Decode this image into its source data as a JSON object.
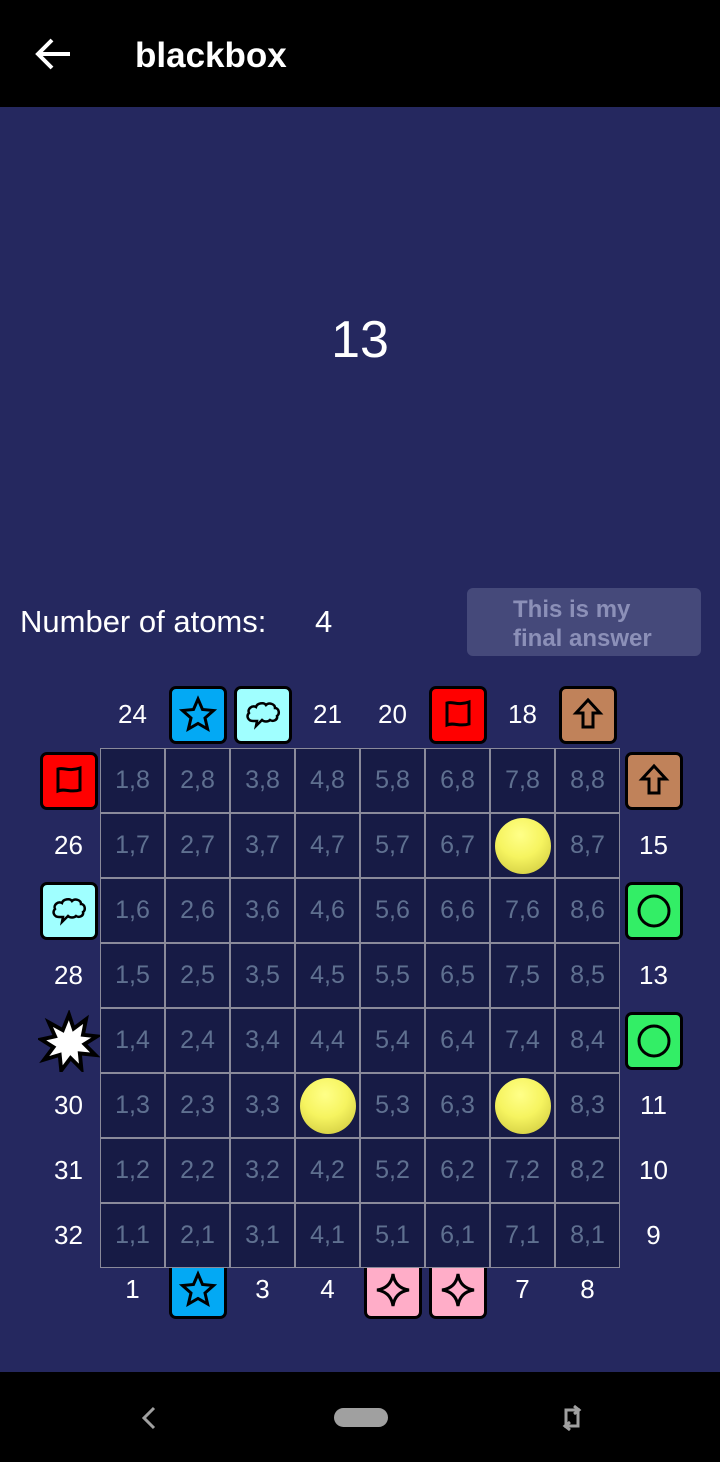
{
  "app": {
    "title": "blackbox",
    "back_icon": "arrow-left-icon"
  },
  "score": "13",
  "atoms": {
    "label": "Number of atoms:",
    "count": "4"
  },
  "final_button": {
    "line1": "This is my",
    "line2": "final answer"
  },
  "colors": {
    "background": "#25285f",
    "cell": "#171b45",
    "blue_star": "#03a9f4",
    "cyan_cloud": "#a0ffff",
    "red_flag": "#ff0000",
    "brown_arrow": "#c0825a",
    "green_circle": "#33ee66",
    "pink_sparkle": "#ffadc8"
  },
  "board": {
    "top": [
      {
        "label": "24"
      },
      {
        "marker": "star"
      },
      {
        "marker": "cloud"
      },
      {
        "label": "21"
      },
      {
        "label": "20"
      },
      {
        "marker": "flag"
      },
      {
        "label": "18"
      },
      {
        "marker": "arrow"
      }
    ],
    "bottom": [
      {
        "label": "1"
      },
      {
        "marker": "star"
      },
      {
        "label": "3"
      },
      {
        "label": "4"
      },
      {
        "marker": "sparkle"
      },
      {
        "marker": "sparkle"
      },
      {
        "label": "7"
      },
      {
        "label": "8"
      }
    ],
    "left": [
      {
        "marker": "flag"
      },
      {
        "label": "26"
      },
      {
        "marker": "cloud"
      },
      {
        "label": "28"
      },
      {
        "marker": "explosion"
      },
      {
        "label": "30"
      },
      {
        "label": "31"
      },
      {
        "label": "32"
      }
    ],
    "right": [
      {
        "marker": "arrow"
      },
      {
        "label": "15"
      },
      {
        "marker": "circle"
      },
      {
        "label": "13"
      },
      {
        "marker": "circle"
      },
      {
        "label": "11"
      },
      {
        "label": "10"
      },
      {
        "label": "9"
      }
    ],
    "rows": [
      [
        "1,8",
        "2,8",
        "3,8",
        "4,8",
        "5,8",
        "6,8",
        "7,8",
        "8,8"
      ],
      [
        "1,7",
        "2,7",
        "3,7",
        "4,7",
        "5,7",
        "6,7",
        "",
        "8,7"
      ],
      [
        "1,6",
        "2,6",
        "3,6",
        "4,6",
        "5,6",
        "6,6",
        "7,6",
        "8,6"
      ],
      [
        "1,5",
        "2,5",
        "3,5",
        "4,5",
        "5,5",
        "6,5",
        "7,5",
        "8,5"
      ],
      [
        "1,4",
        "2,4",
        "3,4",
        "4,4",
        "5,4",
        "6,4",
        "7,4",
        "8,4"
      ],
      [
        "1,3",
        "2,3",
        "3,3",
        "",
        "5,3",
        "6,3",
        "",
        "8,3"
      ],
      [
        "1,2",
        "2,2",
        "3,2",
        "4,2",
        "5,2",
        "6,2",
        "7,2",
        "8,2"
      ],
      [
        "1,1",
        "2,1",
        "3,1",
        "4,1",
        "5,1",
        "6,1",
        "7,1",
        "8,1"
      ]
    ],
    "atoms": [
      "7,7",
      "4,3",
      "7,3"
    ]
  },
  "navbar": {
    "back_icon": "nav-back-icon",
    "home_icon": "nav-home-icon",
    "rotate_icon": "rotate-icon"
  }
}
